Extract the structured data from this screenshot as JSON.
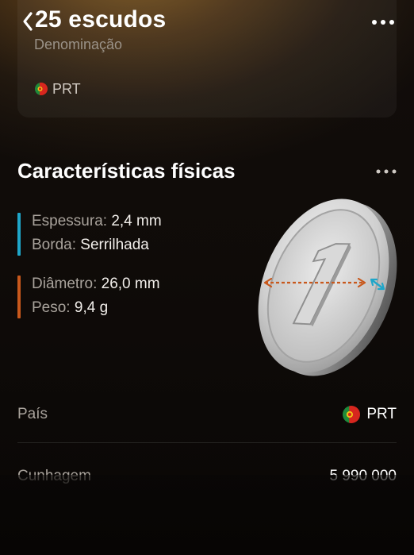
{
  "header": {
    "title": "25 escudos",
    "subtitle": "Denominação",
    "back_icon": "chevron-left-icon",
    "more_icon": "more-horizontal-icon"
  },
  "top_card": {
    "country_code": "PRT",
    "flag_icon": "portugal-flag-icon"
  },
  "physical": {
    "title": "Características físicas",
    "more_icon": "more-horizontal-icon",
    "group1_color": "#1fa6c9",
    "group2_color": "#c8581c",
    "thickness_label": "Espessura:",
    "thickness_value": "2,4 mm",
    "edge_label": "Borda:",
    "edge_value": "Serrilhada",
    "diameter_label": "Diâmetro:",
    "diameter_value": "26,0 mm",
    "weight_label": "Peso:",
    "weight_value": "9,4 g",
    "coin_numeral": "1",
    "coin_icon": "coin-illustration"
  },
  "details": {
    "country_label": "País",
    "country_value": "PRT",
    "mintage_label": "Cunhagem",
    "mintage_value": "5 990 000"
  }
}
